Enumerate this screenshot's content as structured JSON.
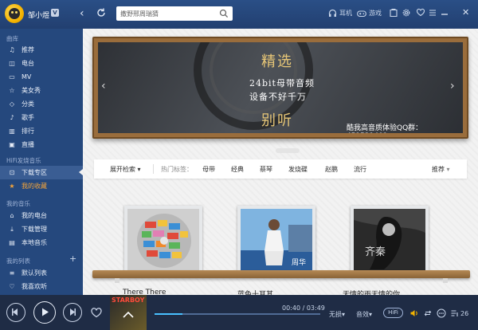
{
  "header": {
    "username": "邹小煜",
    "vip_label": "V",
    "search_placeholder": "撒野邢周瑞猜",
    "earphone_label": "耳机",
    "game_label": "游戏"
  },
  "sidebar": {
    "section_library": "曲库",
    "library_items": [
      {
        "label": "推荐",
        "icon": "music-note-icon"
      },
      {
        "label": "电台",
        "icon": "radio-icon"
      },
      {
        "label": "MV",
        "icon": "mv-icon"
      },
      {
        "label": "美女秀",
        "icon": "star-icon"
      },
      {
        "label": "分类",
        "icon": "tag-icon"
      },
      {
        "label": "歌手",
        "icon": "singer-icon"
      },
      {
        "label": "排行",
        "icon": "chart-icon"
      },
      {
        "label": "直播",
        "icon": "live-icon"
      }
    ],
    "section_hifi": "HiFi发烧音乐",
    "hifi_items": [
      {
        "label": "下载专区",
        "icon": "download-zone-icon",
        "active": true
      },
      {
        "label": "我的收藏",
        "icon": "collect-star-icon"
      }
    ],
    "section_my_music": "我的音乐",
    "my_music_items": [
      {
        "label": "我的电台",
        "icon": "my-radio-icon"
      },
      {
        "label": "下载管理",
        "icon": "download-manage-icon"
      },
      {
        "label": "本地音乐",
        "icon": "local-music-icon"
      }
    ],
    "section_my_list": "我的列表",
    "my_list_items": [
      {
        "label": "默认列表",
        "icon": "playlist-icon"
      },
      {
        "label": "我喜欢听",
        "icon": "heart-icon"
      }
    ]
  },
  "banner": {
    "title_top": "精选",
    "line1": "24bit母带音频",
    "line2": "设备不好千万",
    "title_bottom": "别听",
    "qq_text": "酷我高音质体验QQ群：451521401"
  },
  "filter": {
    "expand_label": "展开检索",
    "hot_tags_label": "热门标签：",
    "tags": [
      "母带",
      "经典",
      "蔡琴",
      "发烧碟",
      "赵鹏",
      "流行"
    ],
    "sort_label": "推荐"
  },
  "albums": [
    {
      "title": "There There"
    },
    {
      "title": "蓝色十耳其"
    },
    {
      "title": "无情的雨无情的你"
    }
  ],
  "player": {
    "cover_text": "STARBOY",
    "time": "00:40 / 03:49",
    "quality_label": "无损",
    "effect_label": "音效",
    "hifi_label": "HiFi",
    "queue_count": "26",
    "progress": 0.17
  },
  "colors": {
    "sidebar_bg": "#25487d",
    "accent_orange": "#f3a43b",
    "banner_gold": "#e8c777",
    "progress": "#49c0ff"
  }
}
